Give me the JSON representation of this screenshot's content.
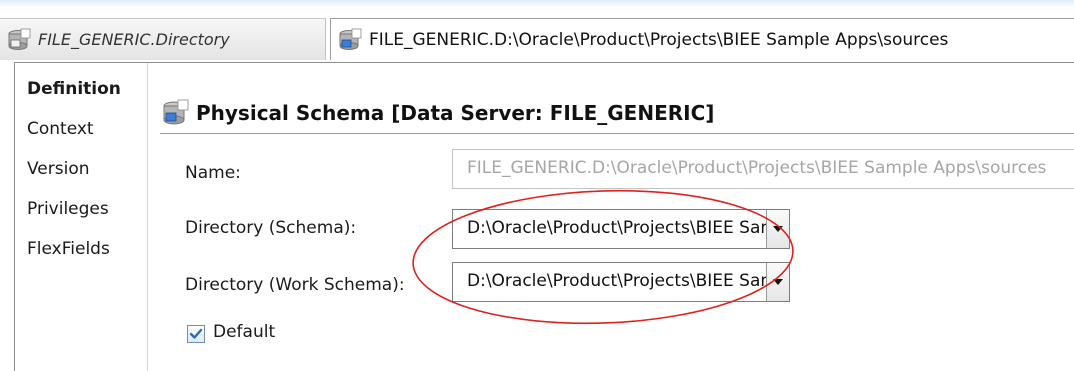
{
  "tabs": [
    {
      "label": "FILE_GENERIC.Directory",
      "icon": "schema-icon",
      "active": false
    },
    {
      "label": "FILE_GENERIC.D:\\Oracle\\Product\\Projects\\BIEE Sample Apps\\sources",
      "icon": "schema-icon",
      "active": true
    }
  ],
  "sidenav": {
    "items": [
      {
        "label": "Definition",
        "selected": true
      },
      {
        "label": "Context",
        "selected": false
      },
      {
        "label": "Version",
        "selected": false
      },
      {
        "label": "Privileges",
        "selected": false
      },
      {
        "label": "FlexFields",
        "selected": false
      }
    ]
  },
  "panel": {
    "title": "Physical Schema [Data Server: FILE_GENERIC]",
    "title_icon": "schema-icon"
  },
  "form": {
    "name_label": "Name:",
    "name_value": "FILE_GENERIC.D:\\Oracle\\Product\\Projects\\BIEE Sample Apps\\sources",
    "directory_label": "Directory (Schema):",
    "directory_value": "D:\\Oracle\\Product\\Projects\\BIEE Sample Apps\\sources",
    "work_directory_label": "Directory (Work Schema):",
    "work_directory_value": "D:\\Oracle\\Product\\Projects\\BIEE Sample Apps\\sources",
    "default_label": "Default",
    "default_checked": true
  },
  "colors": {
    "annotation": "#e0211d",
    "accent": "#2b6cb0"
  }
}
